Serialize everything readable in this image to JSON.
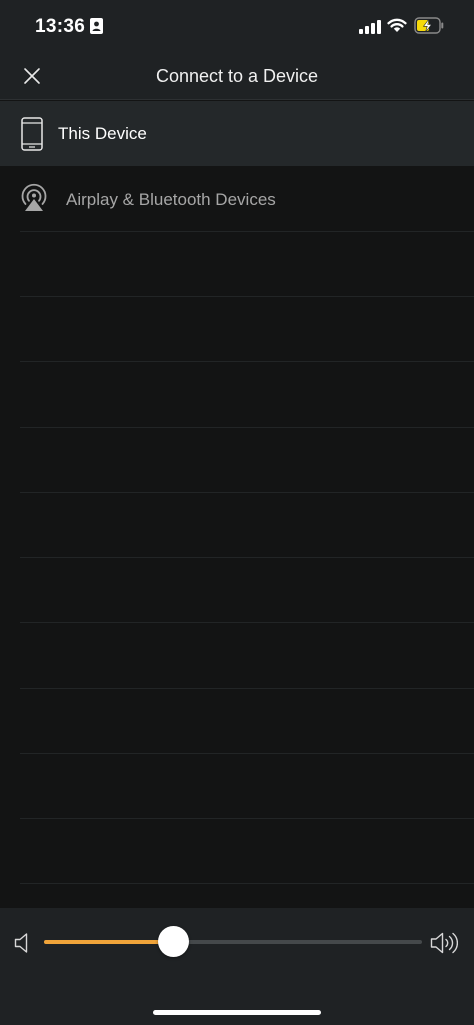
{
  "status_bar": {
    "time": "13:36",
    "icons": [
      "person-card-icon",
      "cellular-signal-icon",
      "wifi-icon",
      "battery-charging-icon"
    ]
  },
  "header": {
    "title": "Connect to a Device",
    "close_icon": "close-icon"
  },
  "devices": [
    {
      "label": "This Device",
      "icon": "phone-icon",
      "selected": true
    },
    {
      "label": "Airplay & Bluetooth Devices",
      "icon": "airplay-icon",
      "selected": false
    }
  ],
  "volume": {
    "level_fraction": 0.34,
    "low_icon": "volume-low-icon",
    "high_icon": "volume-high-icon"
  },
  "colors": {
    "accent": "#f0a43a",
    "battery_charge": "#f5d90a",
    "header_bg": "#1f2224",
    "selected_row_bg": "#24282a",
    "list_bg": "#131414"
  }
}
